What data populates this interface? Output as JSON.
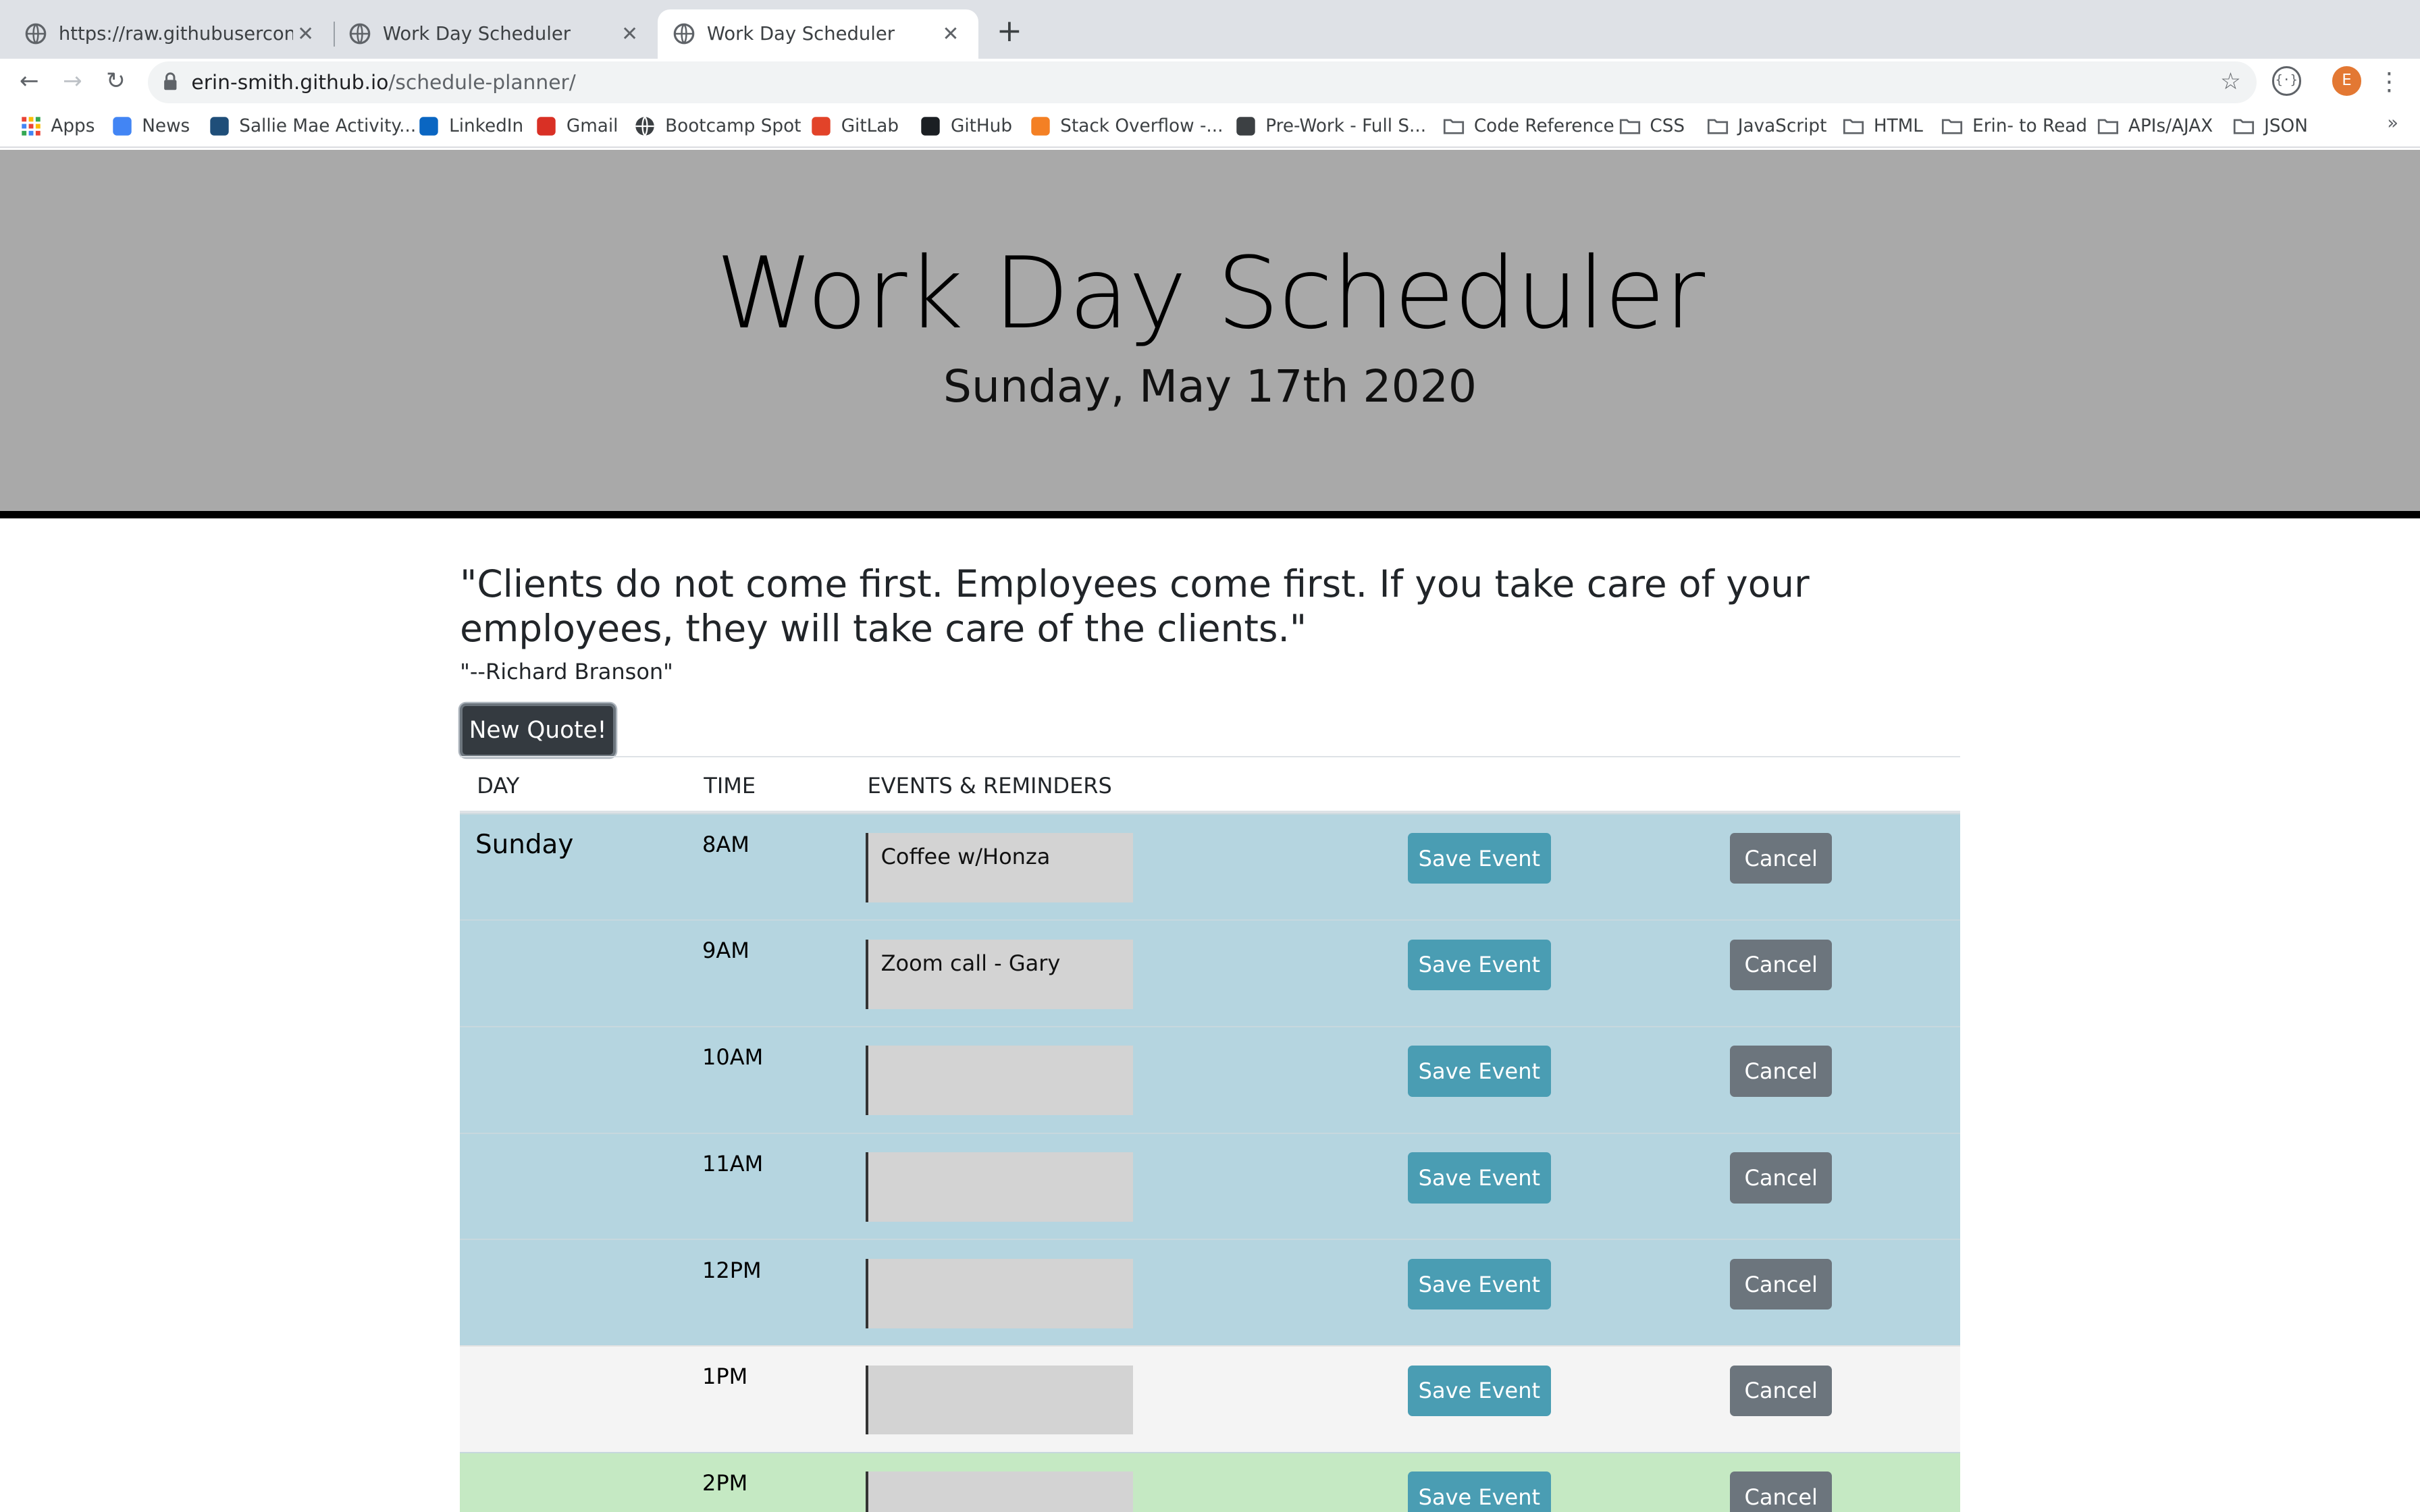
{
  "browser": {
    "tabs": [
      {
        "title": "https://raw.githubusercontent.com",
        "active": false
      },
      {
        "title": "Work Day Scheduler",
        "active": false
      },
      {
        "title": "Work Day Scheduler",
        "active": true
      }
    ],
    "url_host": "erin-smith.github.io",
    "url_path": "/schedule-planner/",
    "profile_initial": "E",
    "bookmarks": [
      {
        "label": "Apps",
        "icon": "apps-grid-icon"
      },
      {
        "label": "News",
        "icon": "news-icon"
      },
      {
        "label": "Sallie Mae Activity...",
        "icon": "sallie-mae-icon"
      },
      {
        "label": "LinkedIn",
        "icon": "linkedin-icon"
      },
      {
        "label": "Gmail",
        "icon": "gmail-icon"
      },
      {
        "label": "Bootcamp Spot",
        "icon": "globe-icon"
      },
      {
        "label": "GitLab",
        "icon": "gitlab-icon"
      },
      {
        "label": "GitHub",
        "icon": "github-icon"
      },
      {
        "label": "Stack Overflow -...",
        "icon": "stackoverflow-icon"
      },
      {
        "label": "Pre-Work  - Full S...",
        "icon": "book-icon"
      },
      {
        "label": "Code Reference",
        "icon": "folder-icon"
      },
      {
        "label": "CSS",
        "icon": "folder-icon"
      },
      {
        "label": "JavaScript",
        "icon": "folder-icon"
      },
      {
        "label": "HTML",
        "icon": "folder-icon"
      },
      {
        "label": "Erin- to Read",
        "icon": "folder-icon"
      },
      {
        "label": "APIs/AJAX",
        "icon": "folder-icon"
      },
      {
        "label": "JSON",
        "icon": "folder-icon"
      }
    ],
    "bookmarks_overflow": "»"
  },
  "header": {
    "title": "Work Day Scheduler",
    "date": "Sunday, May 17th 2020"
  },
  "quote": {
    "text": "\"Clients do not come first. Employees come first. If you take care of your employees, they will take care of the clients.\"",
    "author": "\"--Richard Branson\"",
    "button_label": "New Quote!"
  },
  "table": {
    "headers": [
      "DAY",
      "TIME",
      "EVENTS & REMINDERS"
    ],
    "day": "Sunday",
    "save_label": "Save Event",
    "cancel_label": "Cancel",
    "rows": [
      {
        "hour": "8AM",
        "event": "Coffee w/Honza",
        "state": "past"
      },
      {
        "hour": "9AM",
        "event": "Zoom call - Gary",
        "state": "past"
      },
      {
        "hour": "10AM",
        "event": "",
        "state": "past"
      },
      {
        "hour": "11AM",
        "event": "",
        "state": "past"
      },
      {
        "hour": "12PM",
        "event": "",
        "state": "past"
      },
      {
        "hour": "1PM",
        "event": "",
        "state": "present"
      },
      {
        "hour": "2PM",
        "event": "",
        "state": "future"
      }
    ]
  },
  "colors": {
    "past": "#b5d5e0",
    "present": "#f4f4f4",
    "future": "#c5e9c3",
    "save_button": "#4a9db3",
    "cancel_button": "#6c757d",
    "jumbotron": "#a9a9a9"
  }
}
